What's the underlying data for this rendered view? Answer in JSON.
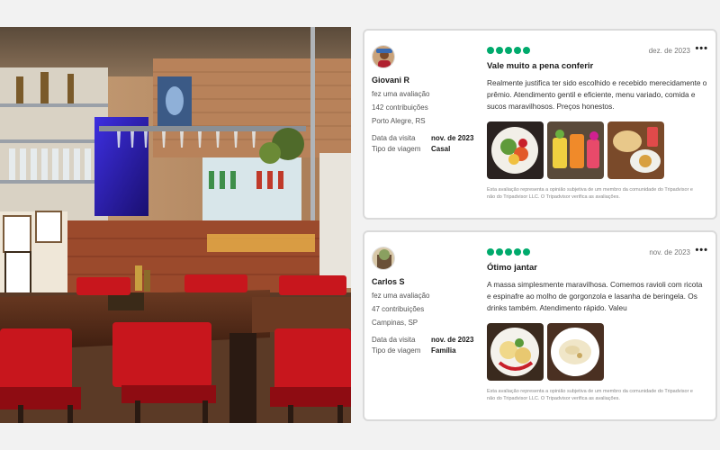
{
  "reviews": [
    {
      "user": {
        "name": "Giovani R",
        "action": "fez uma avaliação",
        "contributions": "142 contribuições",
        "location": "Porto Alegre, RS"
      },
      "date": "dez. de 2023",
      "rating": 5,
      "title": "Vale muito a pena conferir",
      "body": "Realmente justifica ter sido escolhido e recebido merecidamente o prêmio. Atendimento gentil e eficiente, menu variado, comida e sucos maravilhosos. Preços honestos.",
      "visit_label": "Data da visita",
      "visit_value": "nov. de 2023",
      "trip_label": "Tipo de viagem",
      "trip_value": "Casal",
      "disclaimer": "Esta avaliação representa a opinião subjetiva de um membro da comunidade do Tripadvisor e não do Tripadvisor LLC. O Tripadvisor verifica as avaliações.",
      "more_icon": "more-options-icon",
      "photos": [
        "salad-dish-photo",
        "juices-photo",
        "snacks-photo"
      ]
    },
    {
      "user": {
        "name": "Carlos S",
        "action": "fez uma avaliação",
        "contributions": "47 contribuições",
        "location": "Campinas, SP"
      },
      "date": "nov. de 2023",
      "rating": 5,
      "title": "Ótimo jantar",
      "body": "A massa simplesmente maravilhosa. Comemos ravioli com ricota e espinafre ao molho de gorgonzola e lasanha de beringela. Os drinks também. Atendimento rápido. Valeu",
      "visit_label": "Data da visita",
      "visit_value": "nov. de 2023",
      "trip_label": "Tipo de viagem",
      "trip_value": "Família",
      "disclaimer": "Esta avaliação representa a opinião subjetiva de um membro da comunidade do Tripadvisor e não do Tripadvisor LLC. O Tripadvisor verifica as avaliações.",
      "more_icon": "more-options-icon",
      "photos": [
        "ravioli-photo",
        "pasta-plate-photo"
      ]
    }
  ],
  "colors": {
    "rating_bubble": "#00aa6c",
    "chair_red": "#c8161d",
    "card_border": "#dadada"
  }
}
